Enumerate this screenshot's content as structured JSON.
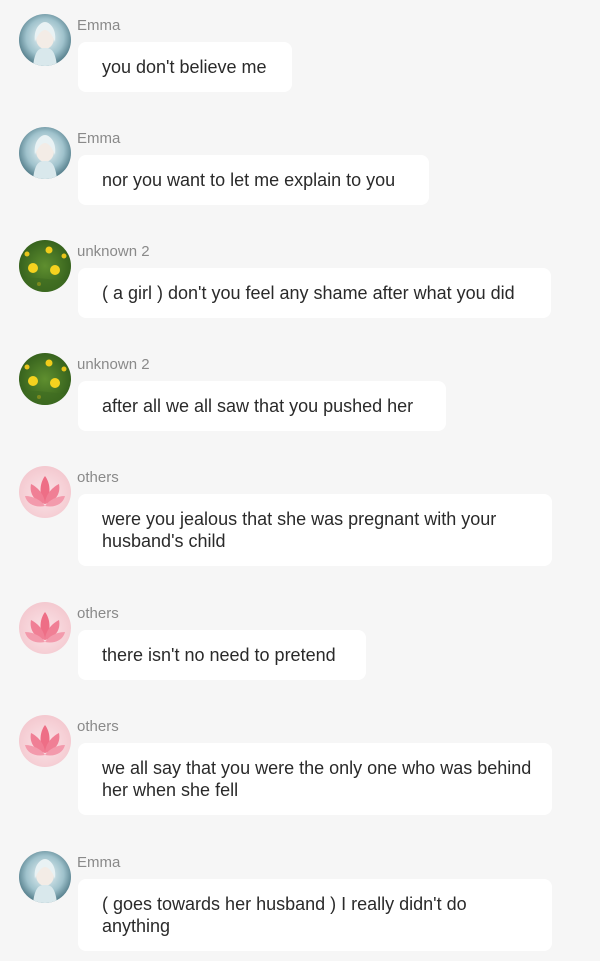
{
  "messages": [
    {
      "sender": "Emma",
      "avatar": "emma-avatar",
      "text": "you don't believe me"
    },
    {
      "sender": "Emma",
      "avatar": "emma-avatar",
      "text": "nor you want to let me explain to you"
    },
    {
      "sender": "unknown 2",
      "avatar": "flowers-avatar",
      "text": "( a girl ) don't you feel any shame after what you did"
    },
    {
      "sender": "unknown 2",
      "avatar": "flowers-avatar",
      "text": "after all we all saw that you pushed her"
    },
    {
      "sender": "others",
      "avatar": "lotus-avatar",
      "text": "were you jealous that she was pregnant with your husband's child"
    },
    {
      "sender": "others",
      "avatar": "lotus-avatar",
      "text": "there isn't no need to pretend"
    },
    {
      "sender": "others",
      "avatar": "lotus-avatar",
      "text": "we all say that you were the only one who was behind her when she fell"
    },
    {
      "sender": "Emma",
      "avatar": "emma-avatar",
      "text": "( goes towards her husband ) I really didn't do anything"
    }
  ],
  "colors": {
    "background": "#f6f6f6",
    "bubble": "#ffffff",
    "sender_text": "#8a8a8a",
    "message_text": "#2a2a2a"
  }
}
